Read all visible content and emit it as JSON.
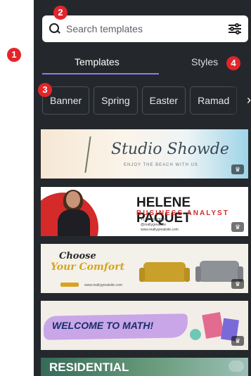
{
  "search": {
    "placeholder": "Search templates"
  },
  "tabs": [
    {
      "label": "Templates",
      "active": true
    },
    {
      "label": "Styles",
      "active": false
    }
  ],
  "chips": [
    "Banner",
    "Spring",
    "Easter",
    "Ramad"
  ],
  "cards": [
    {
      "title": "Studio Showde",
      "subtitle": "ENJOY THE BEACH WITH US"
    },
    {
      "name": "HELENE PAQUET",
      "role": "BUSINESS ANALYST",
      "details": [
        "+123-456-7890",
        "@reallygreatsite",
        "www.reallygreatsite.com"
      ]
    },
    {
      "line1": "Choose",
      "line2": "Your Comfort",
      "site": "www.reallygreatsite.com"
    },
    {
      "title": "WELCOME TO MATH!"
    },
    {
      "title": "RESIDENTIAL"
    }
  ],
  "callouts": [
    "1",
    "2",
    "3",
    "4"
  ],
  "colors": {
    "panel": "#24282c",
    "accent": "#8b7cf6",
    "callout": "#e2252b"
  },
  "icons": [
    "search-icon",
    "filter-sliders-icon",
    "chevron-right-icon",
    "crown-icon"
  ]
}
